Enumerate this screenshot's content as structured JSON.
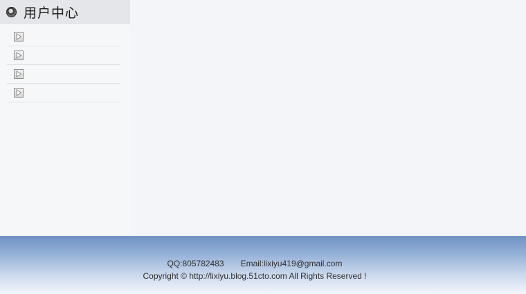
{
  "sidebar": {
    "title": "用户中心",
    "items": [
      {
        "label": ""
      },
      {
        "label": ""
      },
      {
        "label": ""
      },
      {
        "label": ""
      }
    ]
  },
  "footer": {
    "qq": "QQ:805782483",
    "email": "Email:lixiyu419@gmail.com",
    "copyright": "Copyright © http://lixiyu.blog.51cto.com  All Rights Reserved !"
  },
  "icons": {
    "header_bullet": "radio-bullet-icon",
    "menu_item": "play-arrow-icon"
  }
}
